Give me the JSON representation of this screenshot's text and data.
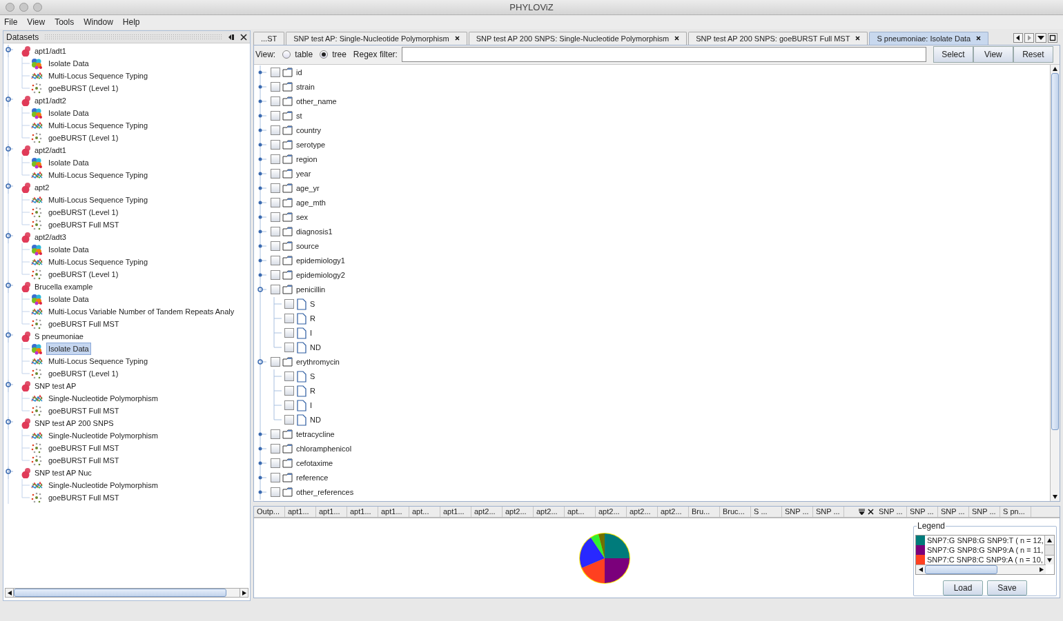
{
  "window": {
    "title": "PHYLOViZ"
  },
  "menu": [
    "File",
    "View",
    "Tools",
    "Window",
    "Help"
  ],
  "datasets_panel": {
    "title": "Datasets",
    "datasets": [
      {
        "label": "apt1/adt1",
        "expanded": true,
        "children": [
          {
            "kind": "isolate",
            "label": "Isolate Data",
            "selected": false
          },
          {
            "kind": "mlst",
            "label": "Multi-Locus Sequence Typing",
            "selected": false
          },
          {
            "kind": "goeburst",
            "label": "goeBURST (Level 1)",
            "selected": false
          }
        ]
      },
      {
        "label": "apt1/adt2",
        "expanded": true,
        "children": [
          {
            "kind": "isolate",
            "label": "Isolate Data",
            "selected": false
          },
          {
            "kind": "mlst",
            "label": "Multi-Locus Sequence Typing",
            "selected": false
          },
          {
            "kind": "goeburst",
            "label": "goeBURST (Level 1)",
            "selected": false
          }
        ]
      },
      {
        "label": "apt2/adt1",
        "expanded": true,
        "children": [
          {
            "kind": "isolate",
            "label": "Isolate Data",
            "selected": false
          },
          {
            "kind": "mlst",
            "label": "Multi-Locus Sequence Typing",
            "selected": false
          }
        ]
      },
      {
        "label": "apt2",
        "expanded": true,
        "children": [
          {
            "kind": "mlst",
            "label": "Multi-Locus Sequence Typing",
            "selected": false
          },
          {
            "kind": "goeburst",
            "label": "goeBURST (Level 1)",
            "selected": false
          },
          {
            "kind": "goeburst",
            "label": "goeBURST Full MST",
            "selected": false
          }
        ]
      },
      {
        "label": "apt2/adt3",
        "expanded": true,
        "children": [
          {
            "kind": "isolate",
            "label": "Isolate Data",
            "selected": false
          },
          {
            "kind": "mlst",
            "label": "Multi-Locus Sequence Typing",
            "selected": false
          },
          {
            "kind": "goeburst",
            "label": "goeBURST (Level 1)",
            "selected": false
          }
        ]
      },
      {
        "label": "Brucella example",
        "expanded": true,
        "children": [
          {
            "kind": "isolate",
            "label": "Isolate Data",
            "selected": false
          },
          {
            "kind": "mlst",
            "label": "Multi-Locus Variable Number of Tandem Repeats Analy",
            "selected": false
          },
          {
            "kind": "goeburst",
            "label": "goeBURST Full MST",
            "selected": false
          }
        ]
      },
      {
        "label": "S pneumoniae",
        "expanded": true,
        "children": [
          {
            "kind": "isolate",
            "label": "Isolate Data",
            "selected": true
          },
          {
            "kind": "mlst",
            "label": "Multi-Locus Sequence Typing",
            "selected": false
          },
          {
            "kind": "goeburst",
            "label": "goeBURST (Level 1)",
            "selected": false
          }
        ]
      },
      {
        "label": "SNP test AP",
        "expanded": true,
        "children": [
          {
            "kind": "mlst",
            "label": "Single-Nucleotide Polymorphism",
            "selected": false
          },
          {
            "kind": "goeburst",
            "label": "goeBURST Full MST",
            "selected": false
          }
        ]
      },
      {
        "label": "SNP test AP 200 SNPS",
        "expanded": true,
        "children": [
          {
            "kind": "mlst",
            "label": "Single-Nucleotide Polymorphism",
            "selected": false
          },
          {
            "kind": "goeburst",
            "label": "goeBURST Full MST",
            "selected": false
          },
          {
            "kind": "goeburst",
            "label": "goeBURST Full MST",
            "selected": false
          }
        ]
      },
      {
        "label": "SNP test AP Nuc",
        "expanded": true,
        "children": [
          {
            "kind": "mlst",
            "label": "Single-Nucleotide Polymorphism",
            "selected": false
          },
          {
            "kind": "goeburst",
            "label": "goeBURST Full MST",
            "selected": false
          }
        ]
      }
    ]
  },
  "editor_tabs": [
    {
      "label": "...ST",
      "selected": false,
      "closable": false
    },
    {
      "label": "SNP test AP: Single-Nucleotide Polymorphism",
      "selected": false,
      "closable": true
    },
    {
      "label": "SNP test AP 200 SNPS: Single-Nucleotide Polymorphism",
      "selected": false,
      "closable": true
    },
    {
      "label": "SNP test AP 200 SNPS: goeBURST Full MST",
      "selected": false,
      "closable": true
    },
    {
      "label": "S pneumoniae: Isolate Data",
      "selected": true,
      "closable": true
    }
  ],
  "view_bar": {
    "label": "View:",
    "options": [
      {
        "label": "table",
        "selected": false
      },
      {
        "label": "tree",
        "selected": true
      }
    ],
    "filter_label": "Regex filter:",
    "buttons": [
      "Select",
      "View",
      "Reset"
    ]
  },
  "attributes": [
    {
      "label": "id",
      "checked": false,
      "expanded": false
    },
    {
      "label": "strain",
      "checked": false,
      "expanded": false
    },
    {
      "label": "other_name",
      "checked": false,
      "expanded": false
    },
    {
      "label": "st",
      "checked": false,
      "expanded": false
    },
    {
      "label": "country",
      "checked": false,
      "expanded": false
    },
    {
      "label": "serotype",
      "checked": false,
      "expanded": false
    },
    {
      "label": "region",
      "checked": false,
      "expanded": false
    },
    {
      "label": "year",
      "checked": false,
      "expanded": false
    },
    {
      "label": "age_yr",
      "checked": false,
      "expanded": false
    },
    {
      "label": "age_mth",
      "checked": false,
      "expanded": false
    },
    {
      "label": "sex",
      "checked": false,
      "expanded": false
    },
    {
      "label": "diagnosis1",
      "checked": false,
      "expanded": false
    },
    {
      "label": "source",
      "checked": false,
      "expanded": false
    },
    {
      "label": "epidemiology1",
      "checked": false,
      "expanded": false
    },
    {
      "label": "epidemiology2",
      "checked": false,
      "expanded": false
    },
    {
      "label": "penicillin",
      "checked": false,
      "expanded": true,
      "children": [
        {
          "label": "S",
          "checked": false
        },
        {
          "label": "R",
          "checked": false
        },
        {
          "label": "I",
          "checked": false
        },
        {
          "label": "ND",
          "checked": false
        }
      ]
    },
    {
      "label": "erythromycin",
      "checked": false,
      "expanded": true,
      "children": [
        {
          "label": "S",
          "checked": false
        },
        {
          "label": "R",
          "checked": false
        },
        {
          "label": "I",
          "checked": false
        },
        {
          "label": "ND",
          "checked": false
        }
      ]
    },
    {
      "label": "tetracycline",
      "checked": false,
      "expanded": false
    },
    {
      "label": "chloramphenicol",
      "checked": false,
      "expanded": false
    },
    {
      "label": "cefotaxime",
      "checked": false,
      "expanded": false
    },
    {
      "label": "reference",
      "checked": false,
      "expanded": false
    },
    {
      "label": "other_references",
      "checked": false,
      "expanded": false
    }
  ],
  "output_tabs_left": [
    "Outp...",
    "apt1...",
    "apt1...",
    "apt1...",
    "apt1...",
    "apt...",
    "apt1...",
    "apt2...",
    "apt2...",
    "apt2...",
    "apt...",
    "apt2...",
    "apt2...",
    "apt2...",
    "Bru...",
    "Bruc...",
    "S ...",
    "SNP ...",
    "SNP ..."
  ],
  "output_tabs_right": [
    "SNP ...",
    "SNP ...",
    "SNP ...",
    "SNP ...",
    "S pn..."
  ],
  "legend": {
    "title": "Legend",
    "items": [
      {
        "label": "SNP7:G SNP8:G SNP9:T ( n = 12,",
        "color": "#007b7b"
      },
      {
        "label": "SNP7:G SNP8:G SNP9:A ( n = 11,",
        "color": "#7b007b"
      },
      {
        "label": "SNP7:C SNP8:C SNP9:A ( n = 10,",
        "color": "#ff4020"
      }
    ],
    "buttons": [
      "Load",
      "Save"
    ]
  }
}
